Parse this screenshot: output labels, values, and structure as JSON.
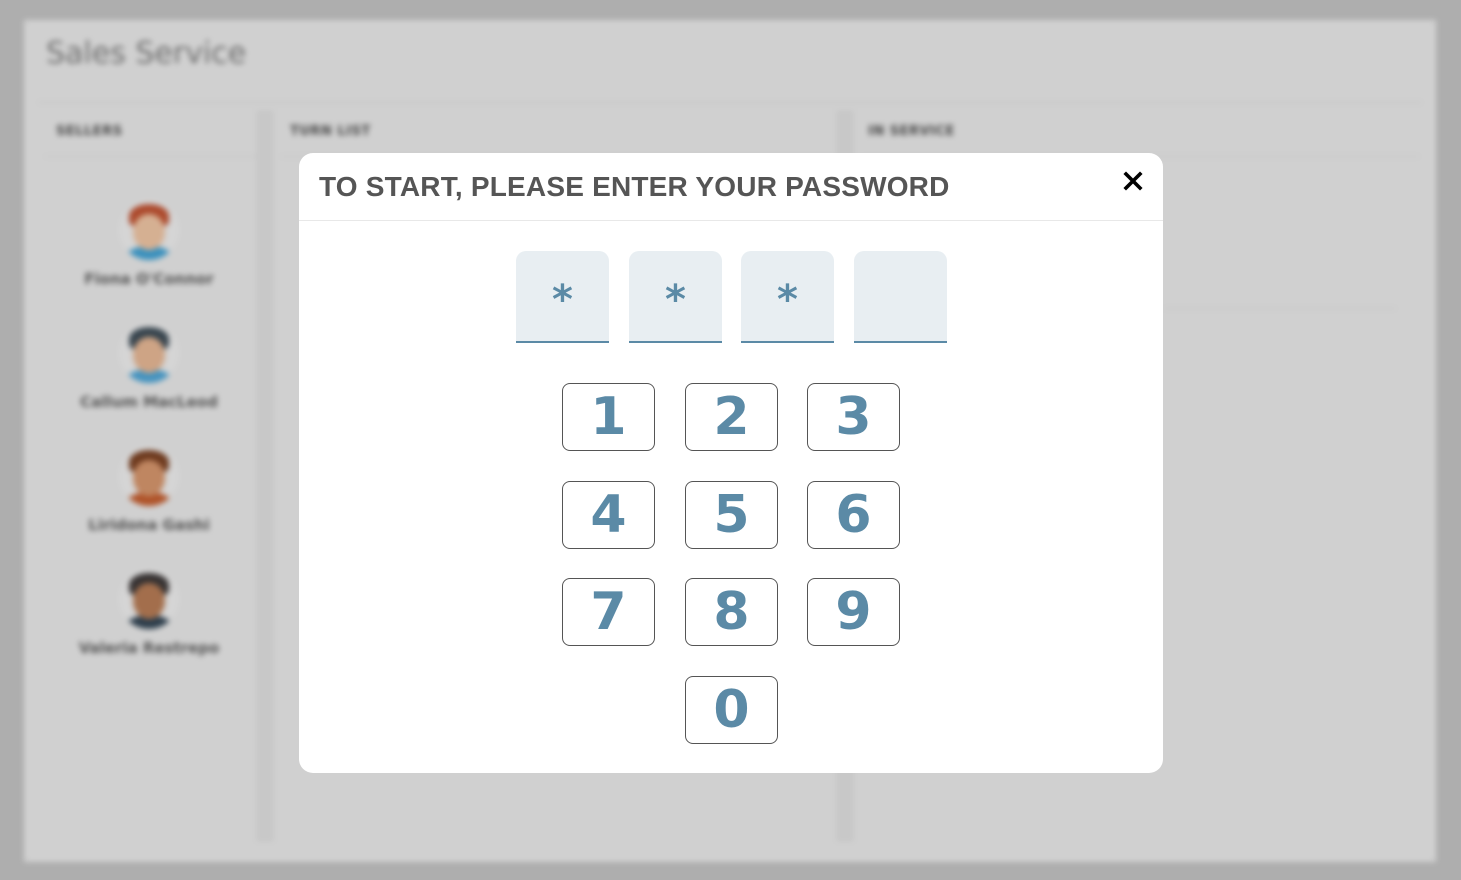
{
  "background": {
    "app_title": "Sales Service",
    "columns": {
      "sellers": "SELLERS",
      "turn_list": "TURN LIST",
      "in_service": "IN SERVICE"
    },
    "sellers": [
      {
        "name": "Fiona O'Connor",
        "hair": "#c2502e",
        "face": "#f2c6a4",
        "body": "#3ea2d6"
      },
      {
        "name": "Callum MacLeod",
        "hair": "#3b4a55",
        "face": "#e9b894",
        "body": "#4aa5d8"
      },
      {
        "name": "Liridona Gashi",
        "hair": "#7a3e1e",
        "face": "#d8956a",
        "body": "#c65b2a"
      },
      {
        "name": "Valeria Restrepo",
        "hair": "#3a3535",
        "face": "#b77a52",
        "body": "#2f4252"
      }
    ]
  },
  "modal": {
    "title": "TO START, PLEASE ENTER YOUR PASSWORD",
    "close_icon": "close-icon",
    "pin_slots": [
      "*",
      "*",
      "*",
      ""
    ],
    "keypad": [
      "1",
      "2",
      "3",
      "4",
      "5",
      "6",
      "7",
      "8",
      "9",
      "0"
    ]
  },
  "colors": {
    "accent": "#5b8aa6",
    "pin_bg": "#e8eef2",
    "title": "#555555"
  }
}
